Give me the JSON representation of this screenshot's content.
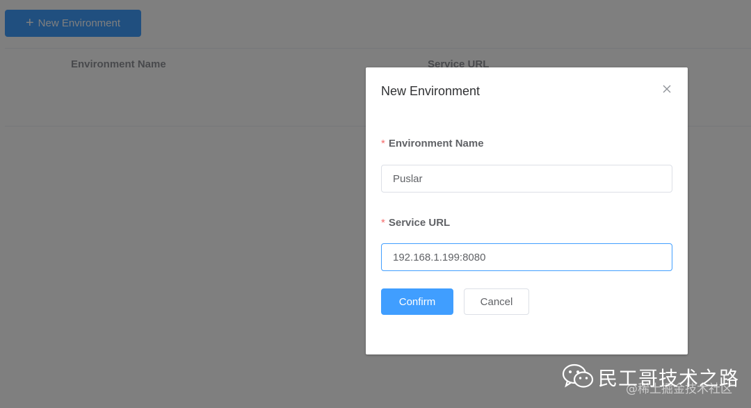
{
  "toolbar": {
    "new_env_label": "New Environment",
    "new_env_icon": "plus-icon"
  },
  "table": {
    "columns": [
      "Environment Name",
      "Service URL"
    ]
  },
  "dialog": {
    "title": "New Environment",
    "close_icon": "close-icon",
    "fields": {
      "env_name": {
        "required_mark": "*",
        "label": "Environment Name",
        "value": "Puslar"
      },
      "service_url": {
        "required_mark": "*",
        "label": "Service URL",
        "value": "192.168.1.199:8080"
      }
    },
    "confirm_label": "Confirm",
    "cancel_label": "Cancel"
  },
  "watermark": {
    "icon": "wechat-icon",
    "main": "民工哥技术之路",
    "sub": "@稀土掘金技术社区"
  },
  "colors": {
    "primary": "#409eff",
    "required": "#f56c6c",
    "overlay": "rgba(0,0,0,0.5)"
  }
}
